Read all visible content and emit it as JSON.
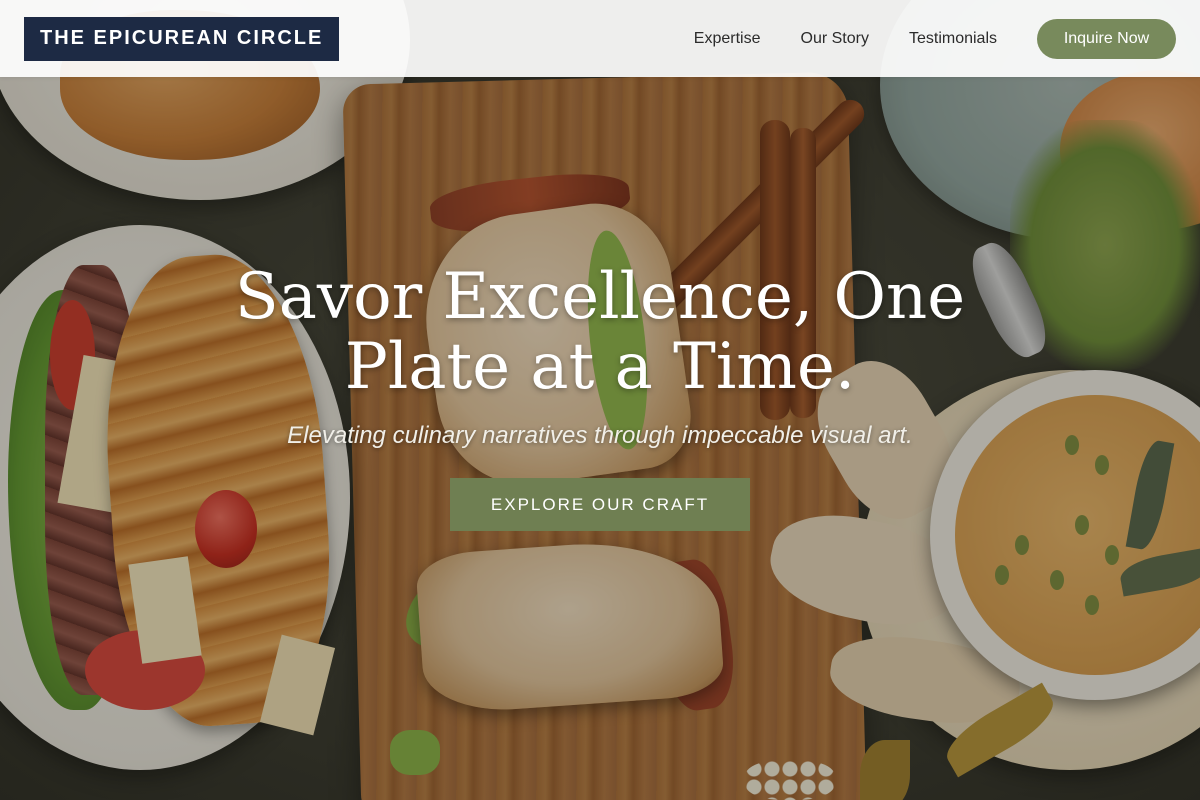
{
  "brand": {
    "logo_text": "THE EPICUREAN CIRCLE"
  },
  "nav": {
    "items": [
      {
        "label": "Expertise"
      },
      {
        "label": "Our Story"
      },
      {
        "label": "Testimonials"
      }
    ],
    "cta_label": "Inquire Now"
  },
  "hero": {
    "title": "Savor Excellence, One Plate at a Time.",
    "subtitle": "Elevating culinary narratives through impeccable visual art.",
    "button_label": "EXPLORE OUR CRAFT",
    "background_image": "food-spread-photo"
  },
  "colors": {
    "logo_bg": "#1d2a44",
    "accent_green": "#788a5c",
    "button_green": "#6f7f52"
  }
}
